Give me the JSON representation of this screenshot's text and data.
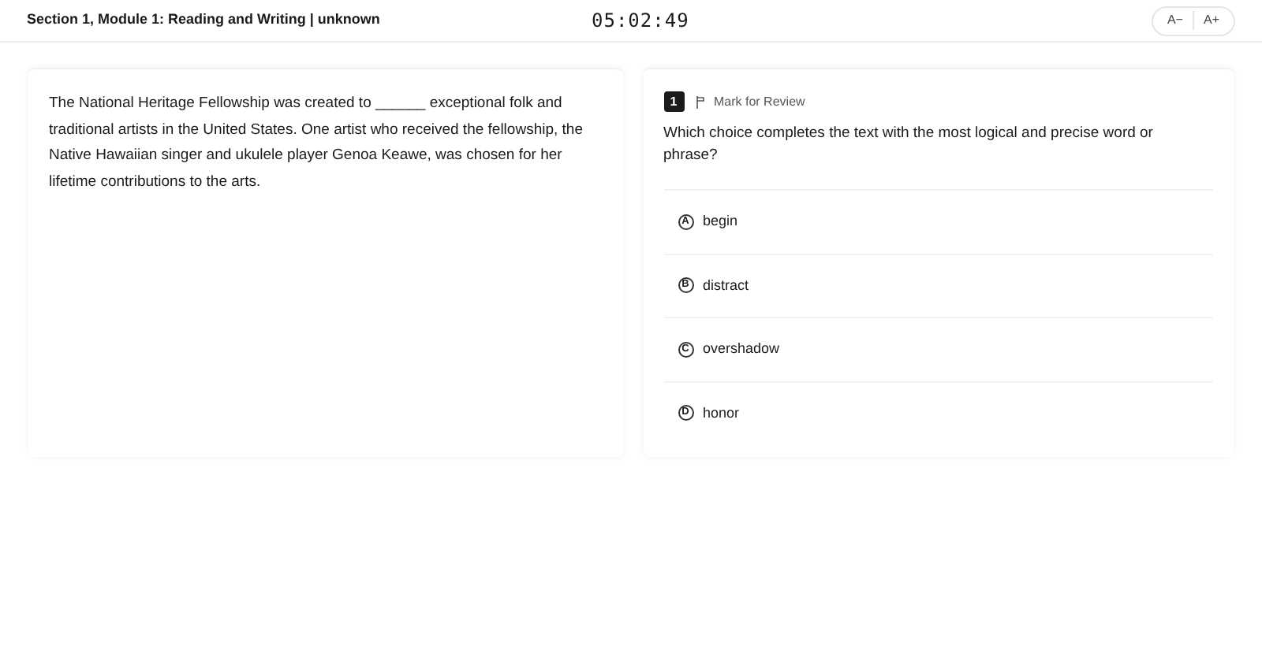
{
  "header": {
    "title": "Section 1, Module 1: Reading and Writing | unknown",
    "timer": "05:02:49",
    "font_buttons": [
      "A−",
      "A+"
    ]
  },
  "passage": {
    "text": "The National Heritage Fellowship was created to ______ exceptional folk and traditional artists in the United States. One artist who received the fellowship, the Native Hawaiian singer and ukulele player Genoa Keawe, was chosen for her lifetime contributions to the arts."
  },
  "question": {
    "number": "1",
    "mark_for_review": {
      "label": "Mark for Review",
      "checked": false
    },
    "prompt": "Which choice completes the text with the most logical and precise word or phrase?",
    "choices": [
      {
        "letter": "A",
        "text": "begin",
        "selected": false
      },
      {
        "letter": "B",
        "text": "distract",
        "selected": false
      },
      {
        "letter": "C",
        "text": "overshadow",
        "selected": false
      },
      {
        "letter": "D",
        "text": "honor",
        "selected": false
      }
    ]
  }
}
